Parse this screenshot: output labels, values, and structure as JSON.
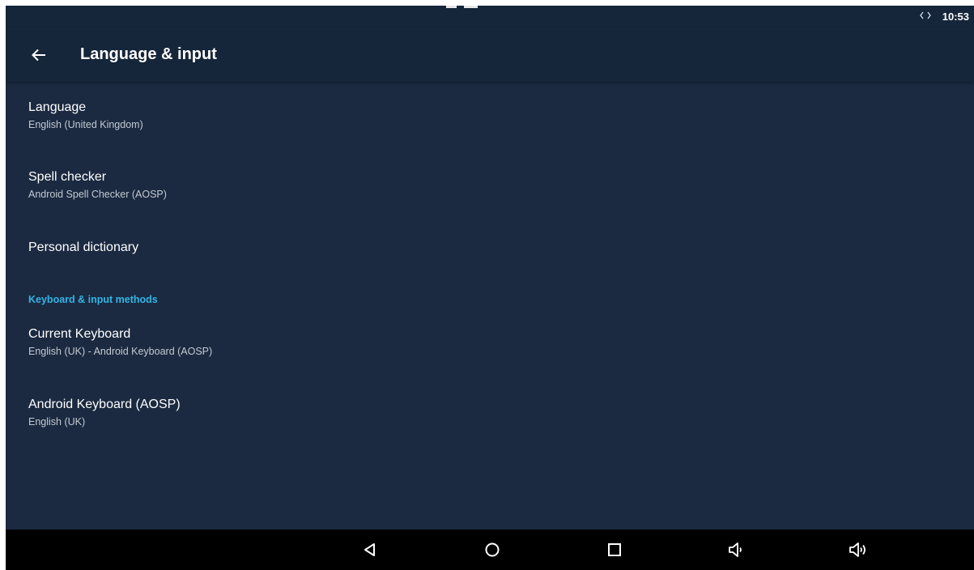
{
  "status_bar": {
    "time": "10:53",
    "icons": [
      "data-transfer-icon"
    ]
  },
  "app_bar": {
    "title": "Language & input",
    "back_icon": "arrow-left-icon"
  },
  "preferences": [
    {
      "id": "language",
      "title": "Language",
      "summary": "English (United Kingdom)"
    },
    {
      "id": "spell-checker",
      "title": "Spell checker",
      "summary": "Android Spell Checker (AOSP)"
    },
    {
      "id": "personal-dictionary",
      "title": "Personal dictionary",
      "summary": ""
    }
  ],
  "keyboard_section": {
    "header": "Keyboard & input methods",
    "items": [
      {
        "id": "current-keyboard",
        "title": "Current Keyboard",
        "summary": "English (UK) - Android Keyboard (AOSP)"
      },
      {
        "id": "android-keyboard",
        "title": "Android Keyboard (AOSP)",
        "summary": "English (UK)"
      }
    ]
  },
  "nav_bar": {
    "buttons": [
      "back-triangle-icon",
      "home-circle-icon",
      "recents-square-icon",
      "volume-down-icon",
      "volume-up-icon"
    ]
  },
  "colors": {
    "background": "#1b2a41",
    "bar": "#15253a",
    "accent": "#33b5e5",
    "nav": "#000000"
  }
}
